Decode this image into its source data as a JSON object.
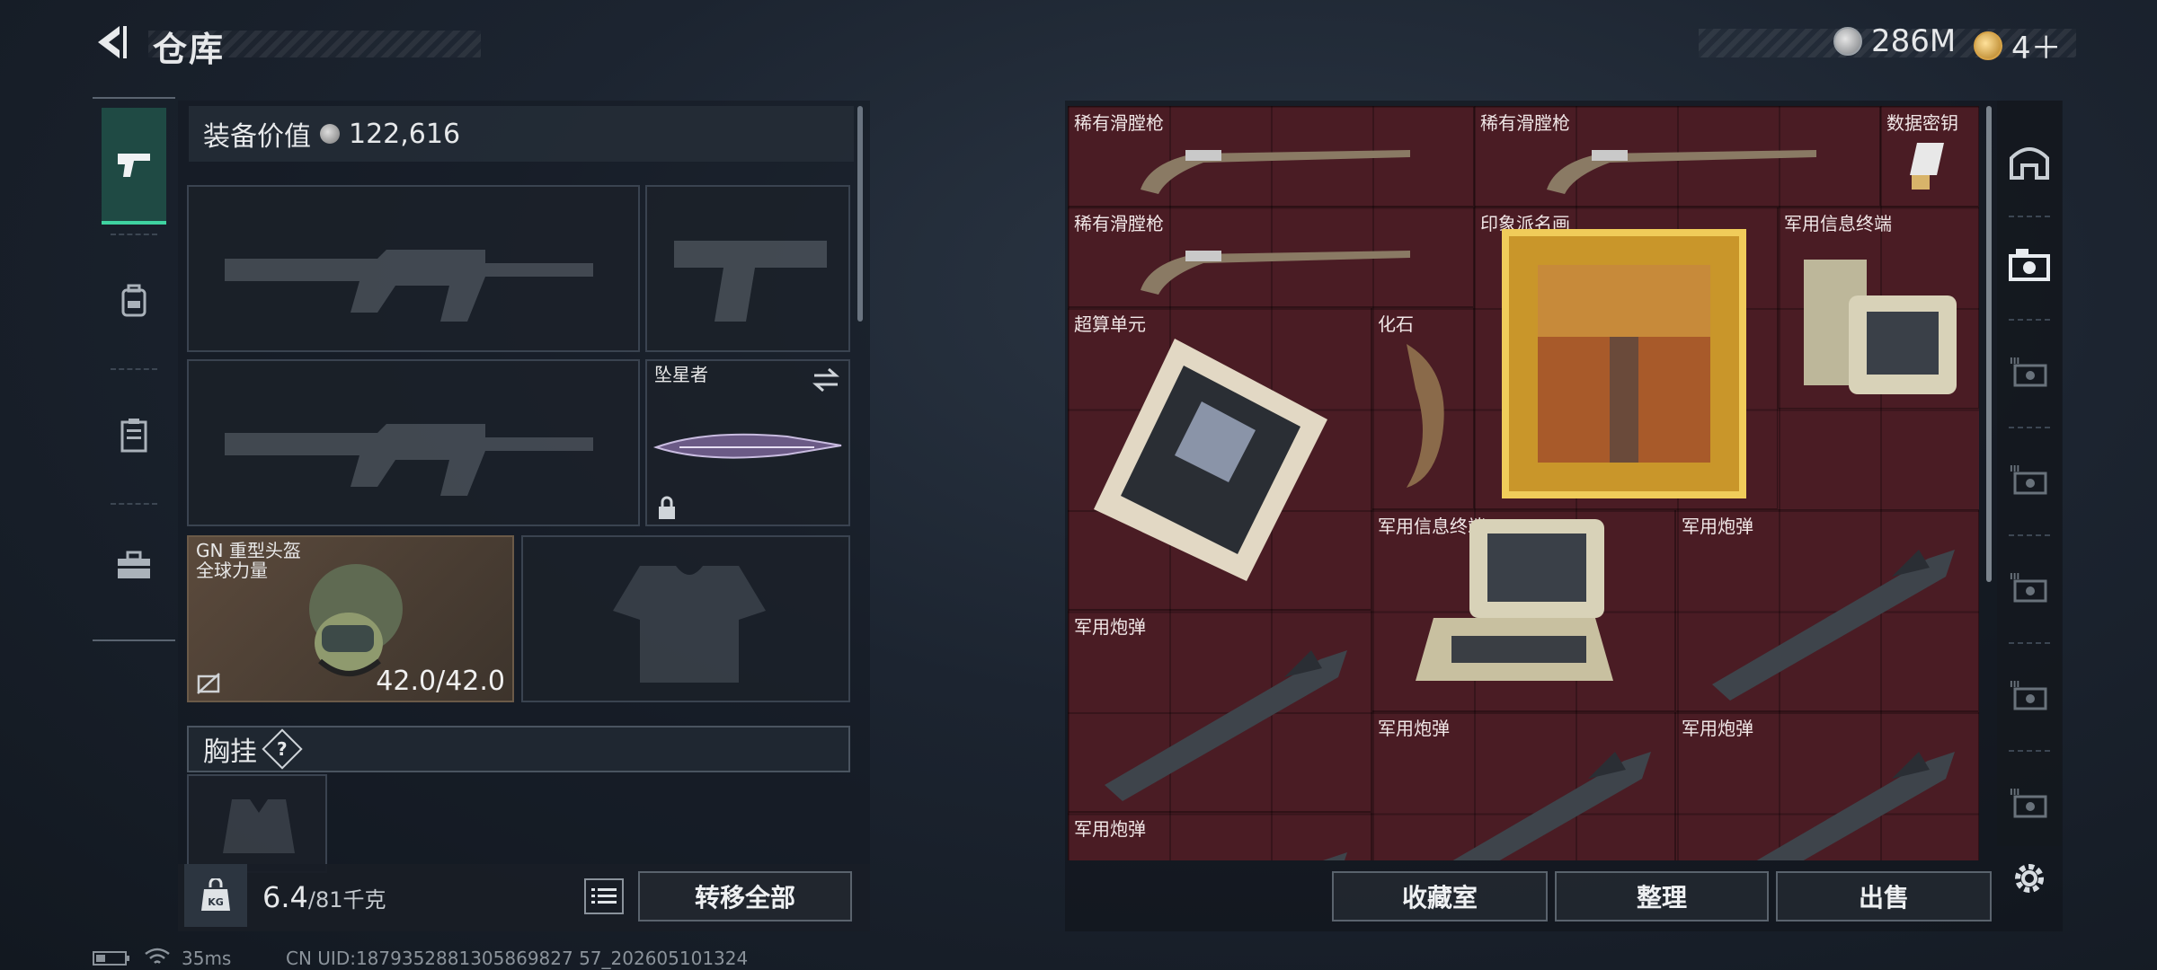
{
  "header": {
    "title": "仓库",
    "silver_amount": "286M",
    "gold_amount": "4＋"
  },
  "loadout": {
    "value_label": "装备价值",
    "value": "122,616",
    "melee_name": "坠星者",
    "helmet_name": "GN 重型头盔",
    "helmet_sub": "全球力量",
    "helmet_durability": "42.0/42.0",
    "section_chest": "胸挂",
    "help_glyph": "?"
  },
  "bottom": {
    "weight_current": "6.4",
    "weight_max": "/81千克",
    "transfer_all": "转移全部",
    "collection": "收藏室",
    "organize": "整理",
    "sell": "出售"
  },
  "stash_items": [
    {
      "label": "稀有滑膛枪"
    },
    {
      "label": "稀有滑膛枪"
    },
    {
      "label": "数据密钥"
    },
    {
      "label": "稀有滑膛枪"
    },
    {
      "label": "印象派名画"
    },
    {
      "label": "军用信息终端"
    },
    {
      "label": "超算单元"
    },
    {
      "label": "化石"
    },
    {
      "label": "军用信息终端"
    },
    {
      "label": "军用炮弹"
    },
    {
      "label": "军用炮弹"
    },
    {
      "label": "军用炮弹"
    },
    {
      "label": "军用炮弹"
    },
    {
      "label": "军用炮弹"
    }
  ],
  "status": {
    "ping": "35ms",
    "uid": "CN UID:1879352881305869827 57_202605101324"
  },
  "icons": {
    "back": "back-arrow-icon",
    "rail": [
      "pistol-icon",
      "backpack-icon",
      "chest-rig-icon",
      "toolbox-icon"
    ],
    "right_rail": [
      "stash-icon",
      "camera-icon",
      "locked-slot-icon",
      "settings-icon"
    ]
  },
  "colors": {
    "stash_bg": "#4a1c24",
    "active_tab": "#3fd3a0"
  }
}
